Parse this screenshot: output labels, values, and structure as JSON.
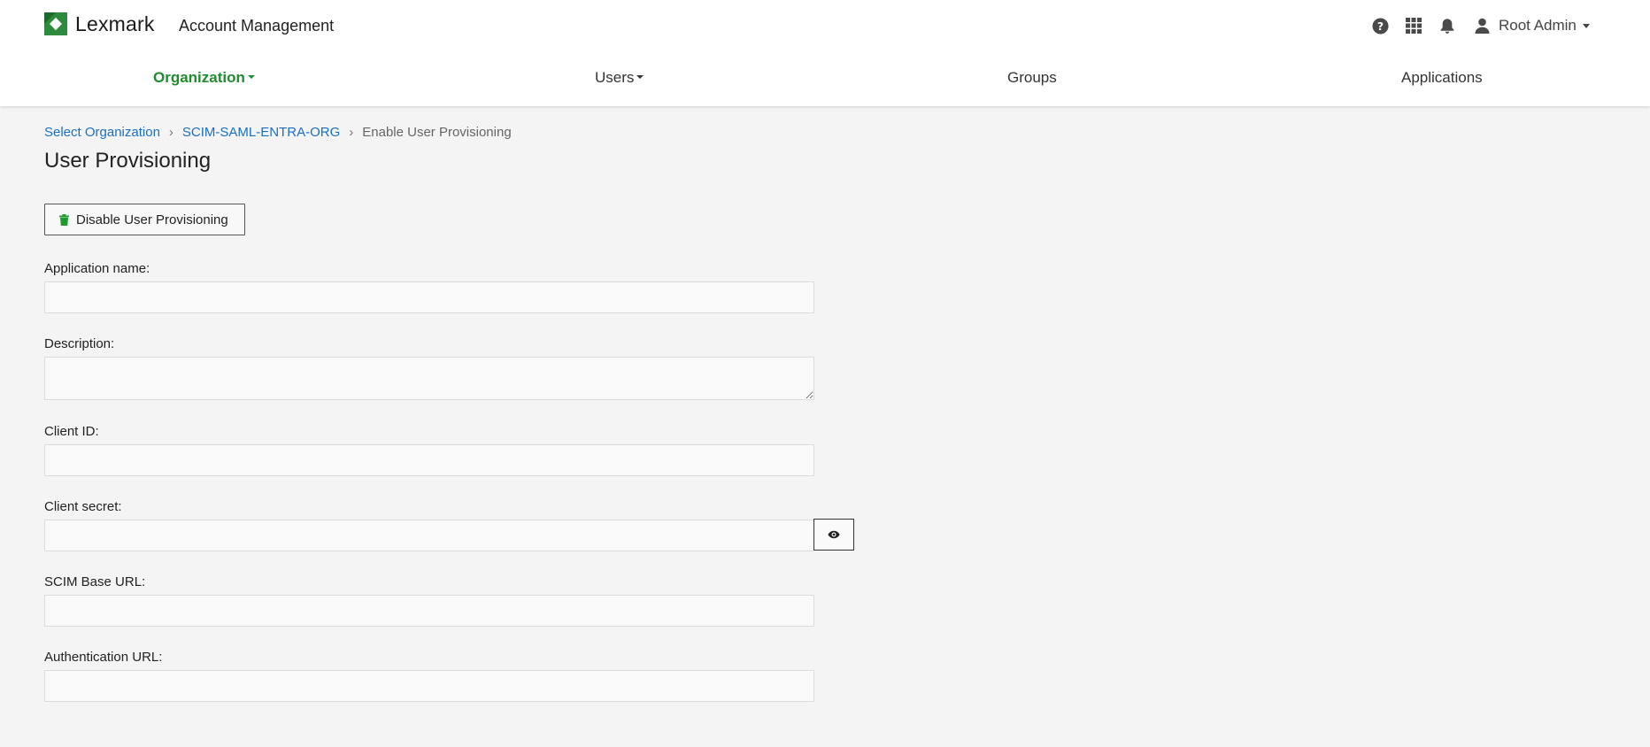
{
  "header": {
    "brand": "Lexmark",
    "app_title": "Account Management",
    "user_name": "Root Admin"
  },
  "nav": {
    "organization": "Organization",
    "users": "Users",
    "groups": "Groups",
    "applications": "Applications"
  },
  "breadcrumb": {
    "select_org": "Select Organization",
    "org_name": "SCIM-SAML-ENTRA-ORG",
    "current": "Enable User Provisioning"
  },
  "page": {
    "title": "User Provisioning",
    "disable_button": "Disable User Provisioning"
  },
  "form": {
    "app_name_label": "Application name:",
    "app_name_value": "",
    "description_label": "Description:",
    "description_value": "",
    "client_id_label": "Client ID:",
    "client_id_value": "",
    "client_secret_label": "Client secret:",
    "client_secret_value": "",
    "scim_base_url_label": "SCIM Base URL:",
    "scim_base_url_value": "",
    "auth_url_label": "Authentication URL:",
    "auth_url_value": ""
  },
  "colors": {
    "brand_green": "#2e8b3d",
    "nav_active": "#1f8c2e",
    "link_blue": "#1a6fc4",
    "page_bg": "#f4f4f4"
  }
}
